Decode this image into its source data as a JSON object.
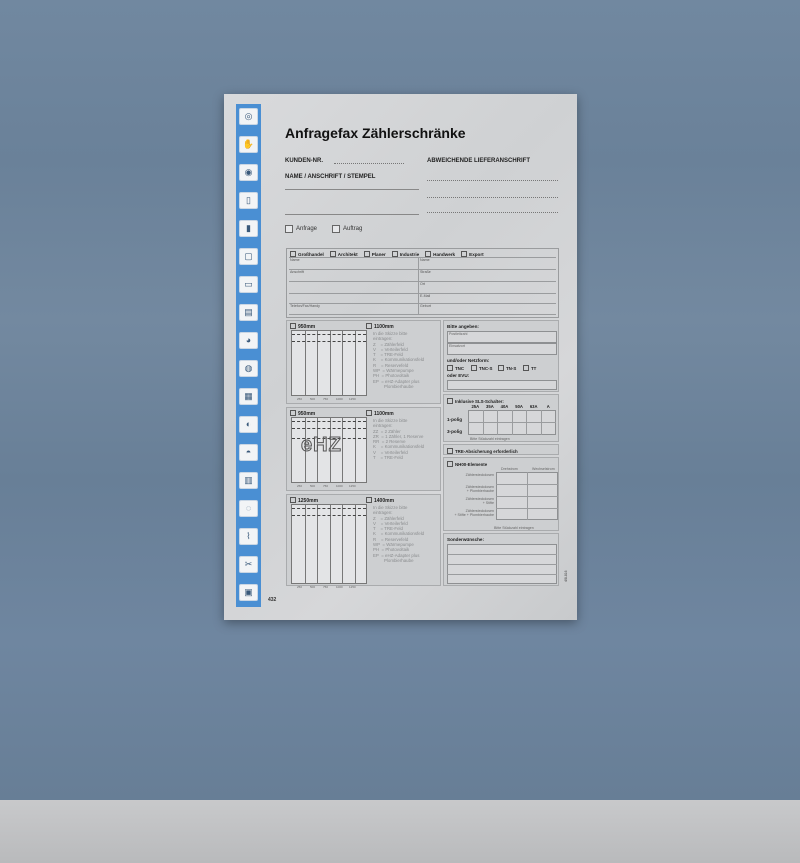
{
  "document": {
    "title": "Anfragefax Zählerschränke",
    "page_number": "432",
    "side_code": "4/8-816",
    "fields": {
      "kunden_nr": "KUNDEN-NR.",
      "name_anschrift": "NAME / ANSCHRIFT / STEMPEL",
      "lieferanschrift": "ABWEICHENDE LIEFERANSCHRIFT"
    },
    "checkboxes": {
      "anfrage": "Anfrage",
      "auftrag": "Auftrag"
    },
    "categories": [
      "Großhandel",
      "Architekt",
      "Planer",
      "Industrie",
      "Handwerk",
      "Export"
    ],
    "contact_fields": [
      "Name",
      "Name",
      "Anschrift",
      "Straße",
      "",
      "Ort",
      "",
      "E-Mail",
      "Telefon/Fax/Handy",
      "Geburt"
    ],
    "panels": [
      {
        "options": [
          "950mm",
          "1100mm"
        ],
        "dims": [
          "250",
          "500",
          "750",
          "1000",
          "1250"
        ],
        "legend": "In die Skizze bitte\neintragen:\nZ    = Zählerfeld\nV    = Verteilerfeld\nT    = TRE-Feld\nK    = Kommunikationsfeld\nR    = Reservefeld\nWP  = Wärmepumpe\nPH  = Photovoltaik\nEP  = eHZ-Adapter plus\n         Plombierhaube"
      },
      {
        "options": [
          "950mm",
          "1100mm"
        ],
        "dims": [
          "250",
          "500",
          "750",
          "1000",
          "1250"
        ],
        "badge": "eHZ",
        "legend": "In die Skizze bitte\neintragen:\nZZ  = 2 Zähler\nZR  = 1 Zähler, 1 Reserve\nRR  = 2 Reserve\nK    = Kommunikationsfeld\nV    = Verteilerfeld\nT    = TRE-Feld"
      },
      {
        "options": [
          "1250mm",
          "1400mm"
        ],
        "dims": [
          "250",
          "500",
          "750",
          "1000",
          "1250"
        ],
        "legend": "In die Skizze bitte\neintragen:\nZ    = Zählerfeld\nV    = Verteilerfeld\nT    = TRE-Feld\nK    = Kommunikationsfeld\nR    = Reservefeld\nWP  = Wärmepumpe\nPH  = Photovoltaik\nEP  = eHZ-Adapter plus\n         Plombierhaube"
      }
    ],
    "right": {
      "bitte_angeben": "Bitte angeben:",
      "postleitzahl": "Postleitzahl",
      "einsatzort": "Einsatzort",
      "netzform_label": "und/oder Netzform:",
      "netzformen": [
        "TNC",
        "TNC-S",
        "TN-S",
        "TT"
      ],
      "evu_label": "oder EVU:",
      "sls_label": "Inklusive SLS-Schalter:",
      "sls_columns": [
        "25A",
        "35A",
        "40A",
        "50A",
        "63A",
        "A"
      ],
      "sls_rows": [
        "1-polig",
        "3-polig"
      ],
      "sls_note": "Bitte Stückzahl eintragen",
      "tre_label": "TRE-Absicherung erforderlich",
      "nh00_label": "NH00-Elemente",
      "nh_columns": [
        "Drehstrom",
        "Wechselstrom"
      ],
      "nh_rows": [
        "Zählersteckdosen",
        "Zählersteckdosen\n+ Plombierhaube",
        "Zählersteckdosen\n+ Stifte",
        "Zählersteckdosen\n+ Stifte + Plombierhaube"
      ],
      "nh_note": "Bitte Stückzahl eintragen",
      "sonder_label": "Sonderwünsche:"
    }
  },
  "colors": {
    "rail": "#4a8fd3",
    "background": "#6b8299"
  },
  "rail_icons": [
    "ring-icon",
    "hand-icon",
    "fuse-icon",
    "switch-icon",
    "terminal-icon",
    "frame-icon",
    "box-icon",
    "enclosure-icon",
    "socket-icon",
    "meter-icon",
    "breaker-icon",
    "tool-icon",
    "lamp-icon",
    "panel-icon",
    "cable-icon",
    "wire-icon",
    "pliers-icon",
    "plate-icon"
  ]
}
